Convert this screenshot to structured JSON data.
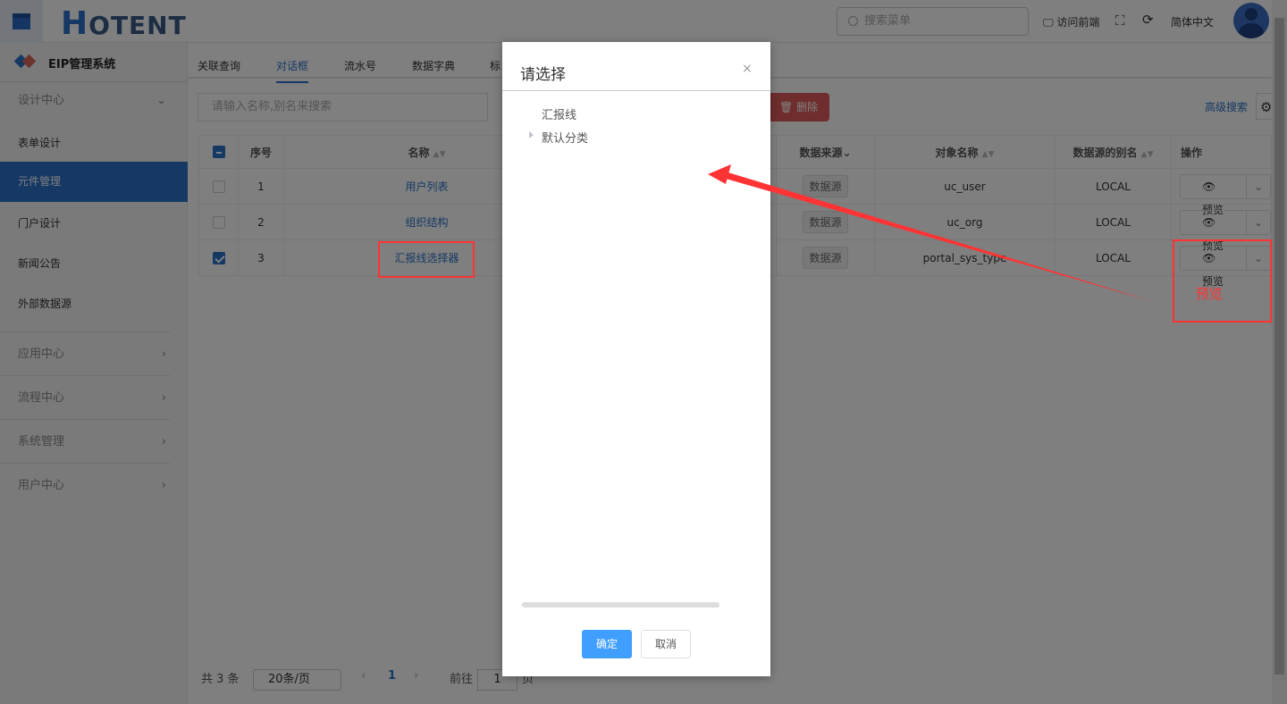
{
  "header": {
    "logo": "HOTENT",
    "search_placeholder": "搜索菜单",
    "visit_frontend": "访问前端",
    "language": "简体中文"
  },
  "sidebar": {
    "title": "EIP管理系统",
    "groups": [
      {
        "label": "设计中心",
        "items": [
          "表单设计",
          "元件管理",
          "门户设计",
          "新闻公告",
          "外部数据源"
        ]
      },
      {
        "label": "应用中心"
      },
      {
        "label": "流程中心"
      },
      {
        "label": "系统管理"
      },
      {
        "label": "用户中心"
      }
    ],
    "active": "元件管理"
  },
  "tabs": [
    "关联查询",
    "对话框",
    "流水号",
    "数据字典",
    "标"
  ],
  "toolbar": {
    "search_placeholder": "请输入名称,别名来搜索",
    "delete": "删除",
    "advanced_search": "高级搜索"
  },
  "table": {
    "headers": [
      "序号",
      "名称",
      "数据来源",
      "对象名称",
      "数据源的别名",
      "操作"
    ],
    "rows": [
      {
        "no": "1",
        "name": "用户列表",
        "source": "数据源",
        "object": "uc_user",
        "alias": "LOCAL",
        "action": "预览",
        "checked": false
      },
      {
        "no": "2",
        "name": "组织结构",
        "source": "数据源",
        "object": "uc_org",
        "alias": "LOCAL",
        "action": "预览",
        "checked": false
      },
      {
        "no": "3",
        "name": "汇报线选择器",
        "source": "数据源",
        "object": "portal_sys_type",
        "alias": "LOCAL",
        "action": "预览",
        "checked": true
      }
    ]
  },
  "pager": {
    "total": "共 3 条",
    "page_size": "20条/页",
    "current": "1",
    "goto_label": "前往",
    "goto_value": "1",
    "page_suffix": "页"
  },
  "modal": {
    "title": "请选择",
    "close": "×",
    "tree": [
      "汇报线",
      "默认分类"
    ],
    "ok": "确定",
    "cancel": "取消"
  },
  "annotation": {
    "text": "预览",
    "color": "#ff3333"
  }
}
